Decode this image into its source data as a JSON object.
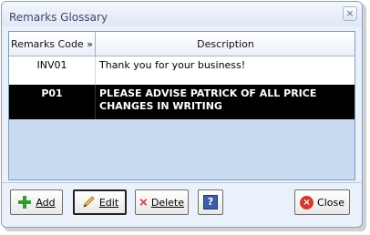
{
  "window": {
    "title": "Remarks Glossary",
    "close_glyph": "×"
  },
  "grid": {
    "columns": [
      "Remarks Code »",
      "Description"
    ],
    "rows": [
      {
        "code": "INV01",
        "description": "Thank you for your business!"
      },
      {
        "code": "P01",
        "description": "PLEASE ADVISE PATRICK OF ALL PRICE CHANGES IN WRITING"
      }
    ],
    "selected_row_index": 1
  },
  "toolbar": {
    "add_label": "Add",
    "edit_label": "Edit",
    "delete_label": "Delete",
    "help_glyph": "?",
    "close_label": "Close"
  },
  "icons": {
    "add": "plus-icon",
    "edit": "pencil-icon",
    "delete": "red-x-icon",
    "help": "help-icon",
    "close": "close-circle-icon"
  },
  "colors": {
    "grid_background": "#c9dbf1",
    "selected_row_bg": "#000000",
    "selected_row_fg": "#ffffff",
    "accent_blue": "#3e5fa8",
    "add_green": "#2da12d",
    "delete_red": "#d23b2f"
  }
}
